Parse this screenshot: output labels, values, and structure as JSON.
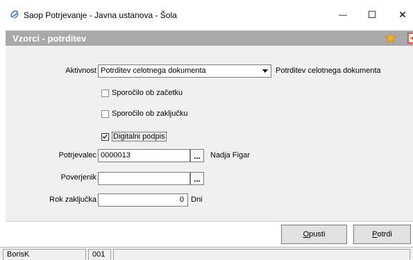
{
  "window": {
    "title": "Saop Potrjevanje - Javna ustanova - Šola",
    "minimize_glyph": "—",
    "maximize_glyph": "☐",
    "close_glyph": "✕"
  },
  "banner": {
    "title": "Vzorci - potrditev"
  },
  "form": {
    "aktivnost": {
      "label": "Aktivnost",
      "value": "Potrditev celotnega dokumenta",
      "description": "Potrditev celotnega dokumenta"
    },
    "checkboxes": [
      {
        "label": "Sporočilo ob začetku",
        "checked": false
      },
      {
        "label": "Sporočilo ob zaključku",
        "checked": false
      },
      {
        "label": "Digitalni podpis",
        "checked": true
      }
    ],
    "potrjevalec": {
      "label": "Potrjevalec",
      "value": "0000013",
      "name": "Nadja Figar"
    },
    "poverjenik": {
      "label": "Poverjenik",
      "value": ""
    },
    "rok": {
      "label": "Rok zaključka",
      "value": "0",
      "unit": "Dni"
    },
    "lookup_glyph": "..."
  },
  "buttons": {
    "cancel": {
      "label_pre": "",
      "label_key": "O",
      "label_post": "pusti"
    },
    "confirm": {
      "label_pre": "",
      "label_key": "P",
      "label_post": "otrdi"
    }
  },
  "status": {
    "user": "BorisK",
    "code": "001"
  },
  "colors": {
    "banner_bg": "#a9a9a9",
    "form_bg": "#f0f0f0",
    "star": "#f2b01e",
    "exit_icon": "#d0361f",
    "app_icon": "#3a6fc4"
  },
  "icons": {
    "app": "app-logo-icon",
    "favorite": "star-icon",
    "exit": "exit-door-icon"
  }
}
